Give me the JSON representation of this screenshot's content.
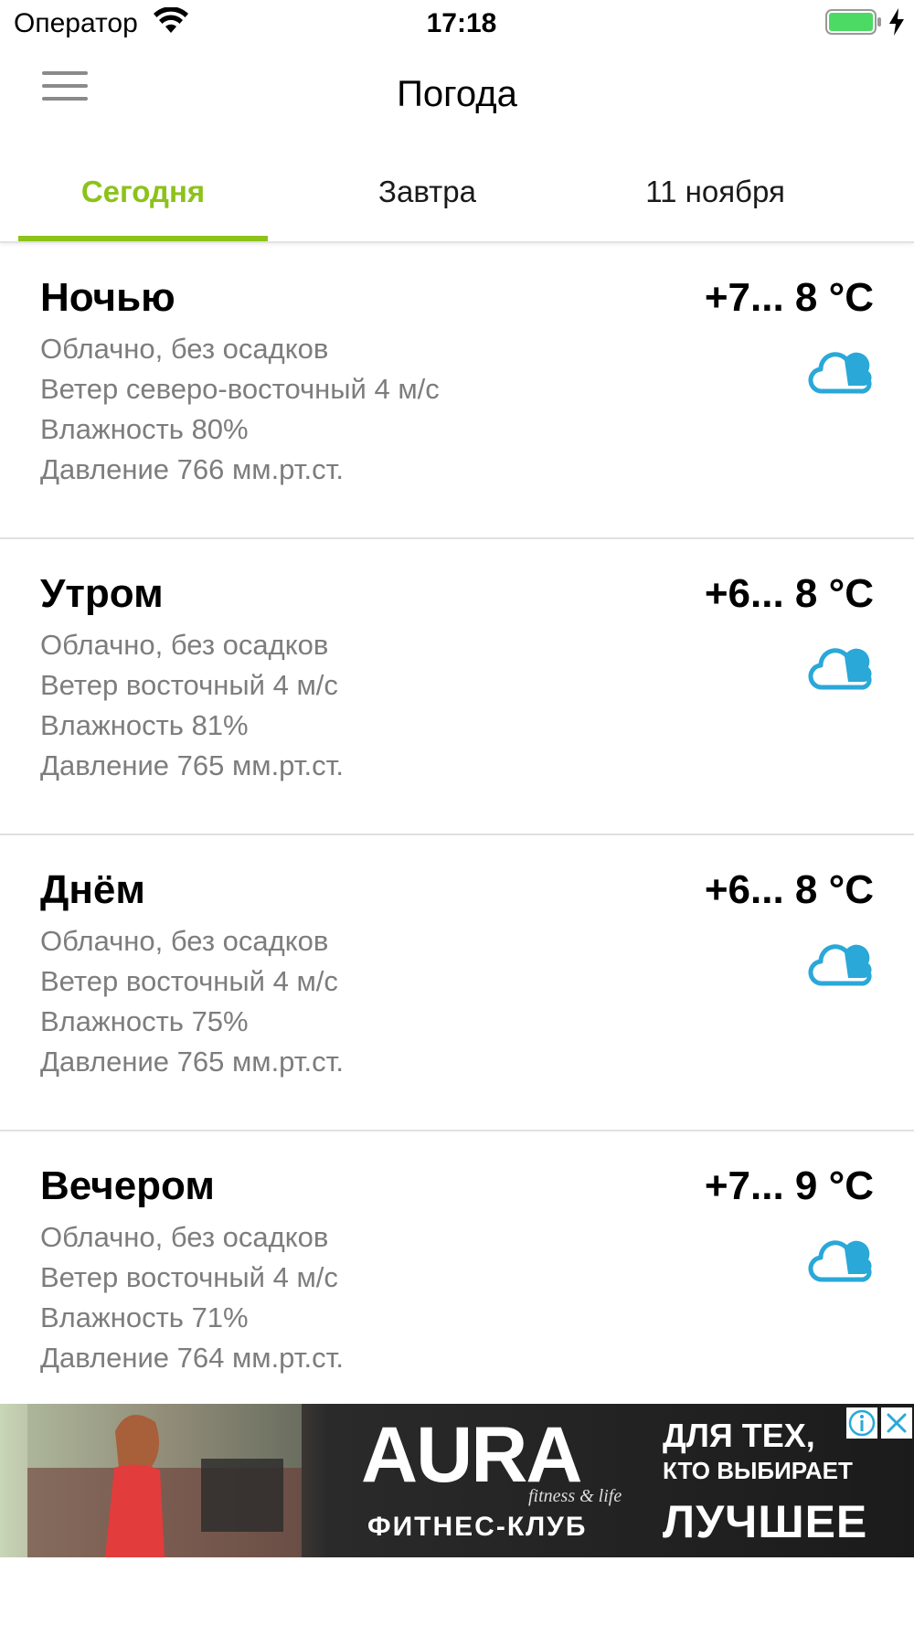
{
  "status_bar": {
    "carrier": "Оператор",
    "time": "17:18"
  },
  "header": {
    "title": "Погода"
  },
  "tabs": [
    {
      "label": "Сегодня",
      "active": true
    },
    {
      "label": "Завтра",
      "active": false
    },
    {
      "label": "11 ноября",
      "active": false
    }
  ],
  "forecast": [
    {
      "period": "Ночью",
      "temperature": "+7... 8 °C",
      "condition": "Облачно, без осадков",
      "wind": "Ветер северо-восточный 4 м/с",
      "humidity": "Влажность 80%",
      "pressure": "Давление 766 мм.рт.ст.",
      "icon": "cloud-icon"
    },
    {
      "period": "Утром",
      "temperature": "+6... 8 °C",
      "condition": "Облачно, без осадков",
      "wind": "Ветер восточный 4 м/с",
      "humidity": "Влажность 81%",
      "pressure": "Давление 765 мм.рт.ст.",
      "icon": "cloud-icon"
    },
    {
      "period": "Днём",
      "temperature": "+6... 8 °C",
      "condition": "Облачно, без осадков",
      "wind": "Ветер восточный 4 м/с",
      "humidity": "Влажность 75%",
      "pressure": "Давление 765 мм.рт.ст.",
      "icon": "cloud-icon"
    },
    {
      "period": "Вечером",
      "temperature": "+7... 9 °C",
      "condition": "Облачно, без осадков",
      "wind": "Ветер восточный 4 м/с",
      "humidity": "Влажность 71%",
      "pressure": "Давление 764 мм.рт.ст.",
      "icon": "cloud-icon"
    }
  ],
  "ad": {
    "brand": "AURA",
    "brand_sub": "fitness & life",
    "club": "ФИТНЕС-КЛУБ",
    "slogan_line1": "ДЛЯ ТЕХ,",
    "slogan_line2": "КТО ВЫБИРАЕТ",
    "slogan_line3": "ЛУЧШЕЕ"
  },
  "colors": {
    "accent": "#8cc21a",
    "icon_blue": "#2aa8d8",
    "secondary_text": "#7d7d7d",
    "battery_green": "#4cd964"
  }
}
